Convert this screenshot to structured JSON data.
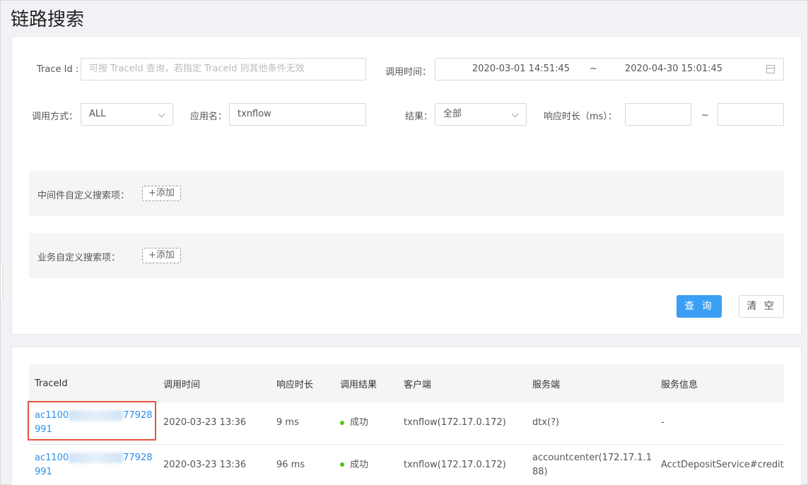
{
  "page": {
    "title": "链路搜索"
  },
  "search": {
    "trace_id": {
      "label": "Trace Id :",
      "placeholder": "可按 TraceId 查询，若指定 TraceId 则其他条件无效"
    },
    "call_time": {
      "label": "调用时间：",
      "start": "2020-03-01 14:51:45",
      "separator": "~",
      "end": "2020-04-30 15:01:45"
    },
    "call_method": {
      "label": "调用方式：",
      "value": "ALL"
    },
    "app_name": {
      "label": "应用名：",
      "value": "txnflow"
    },
    "result": {
      "label": "结果：",
      "value": "全部"
    },
    "duration": {
      "label": "响应时长（ms）：",
      "separator": "~",
      "min": "",
      "max": ""
    },
    "middleware_custom": {
      "label": "中间件自定义搜索项：",
      "add_label": "+添加"
    },
    "business_custom": {
      "label": "业务自定义搜索项：",
      "add_label": "+添加"
    },
    "query_label": "查 询",
    "clear_label": "清 空"
  },
  "results": {
    "columns": [
      "TraceId",
      "调用时间",
      "响应时长",
      "调用结果",
      "客户端",
      "服务端",
      "服务信息"
    ],
    "rows": [
      {
        "trace_prefix": "ac1100",
        "trace_suffix": "77928991",
        "time": "2020-03-23 13:36",
        "duration": "9 ms",
        "result": "成功",
        "client": "txnflow(172.17.0.172)",
        "server": "dtx(?)",
        "service_info": "-"
      },
      {
        "trace_prefix": "ac1100",
        "trace_suffix": "77928991",
        "time": "2020-03-23 13:36",
        "duration": "96 ms",
        "result": "成功",
        "client": "txnflow(172.17.0.172)",
        "server": "accountcenter(172.17.1.188)",
        "service_info": "AcctDepositService#credit"
      }
    ]
  },
  "colors": {
    "primary": "#3a9ff3",
    "link": "#2a8fe8",
    "success": "#52c41a",
    "highlight": "#e5533c"
  }
}
